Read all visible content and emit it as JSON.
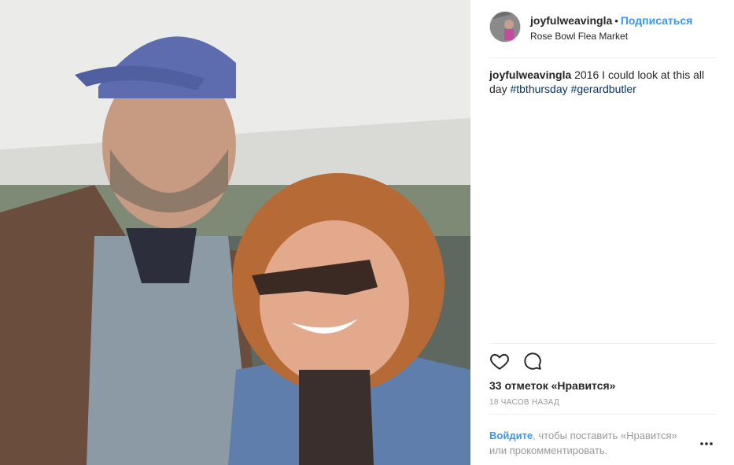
{
  "post": {
    "username": "joyfulweavingla",
    "dot": "•",
    "follow_label": "Подписаться",
    "location": "Rose Bowl Flea Market",
    "caption": {
      "user": "joyfulweavingla",
      "text": "2016 I could look at this all day",
      "tags": [
        "#tbthursday",
        "#gerardbutler"
      ]
    },
    "likes_text": "33 отметок «Нравится»",
    "time_ago": "18 ЧАСОВ НАЗАД",
    "login_prompt": {
      "link": "Войдите",
      "rest": ", чтобы поставить «Нравится» или прокомментировать."
    }
  },
  "icons": {
    "like": "heart-outline-icon",
    "comment": "speech-bubble-icon",
    "more": "more-options-icon"
  },
  "colors": {
    "link_blue": "#3897f0",
    "hashtag": "#003569",
    "muted": "#999999"
  }
}
